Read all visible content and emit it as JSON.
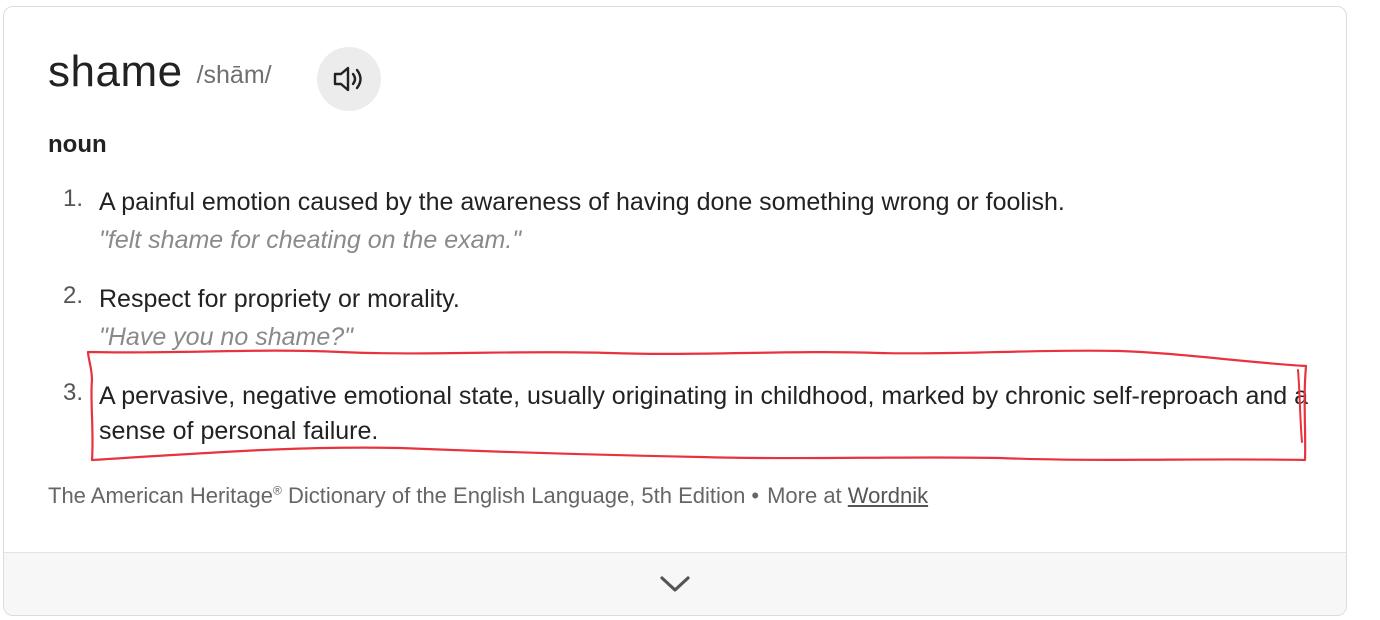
{
  "entry": {
    "headword": "shame",
    "pronunciation": "/shām/",
    "audio_icon": "speaker-icon",
    "part_of_speech": "noun"
  },
  "definitions": [
    {
      "number": "1.",
      "text": "A painful emotion caused by the awareness of having done something wrong or foolish.",
      "example": "\"felt shame for cheating on the exam.\""
    },
    {
      "number": "2.",
      "text": "Respect for propriety or morality.",
      "example": "\"Have you no shame?\""
    },
    {
      "number": "3.",
      "text": "A pervasive, negative emotional state, usually originating in childhood, marked by chronic self-reproach and a sense of personal failure."
    }
  ],
  "source": {
    "dictionary": "The American Heritage",
    "registered_mark": "®",
    "dictionary_rest": " Dictionary of the English Language, 5th Edition",
    "separator": "•",
    "more_at": "More at",
    "link_label": "Wordnik"
  },
  "footer": {
    "expand_icon": "chevron-down-icon"
  },
  "colors": {
    "annotation": "#e8333f"
  }
}
